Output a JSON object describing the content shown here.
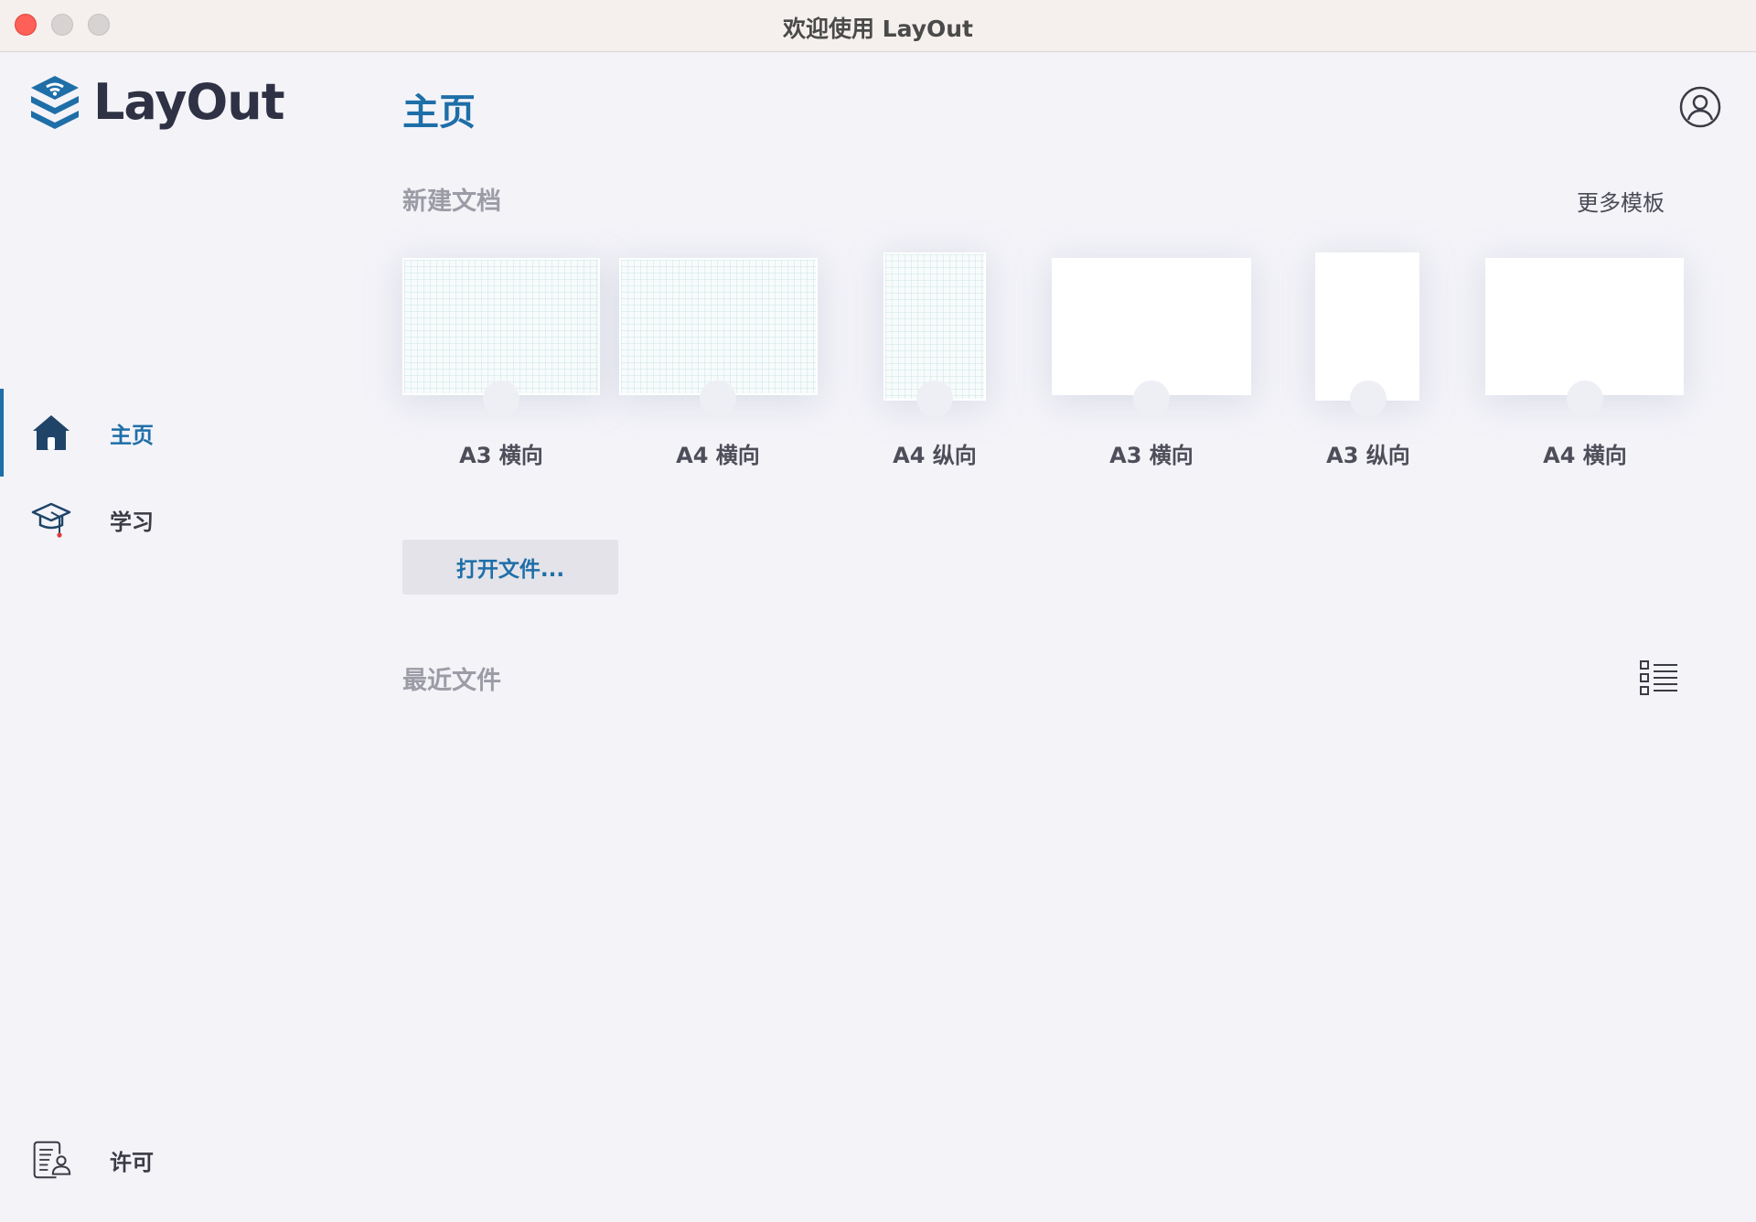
{
  "window": {
    "title": "欢迎使用 LayOut"
  },
  "sidebar": {
    "logo_text": "LayOut",
    "items": [
      {
        "label": "主页",
        "icon": "home-icon",
        "active": true
      },
      {
        "label": "学习",
        "icon": "graduation-cap-icon",
        "active": false
      }
    ],
    "footer_item": {
      "label": "许可",
      "icon": "license-icon"
    }
  },
  "main": {
    "title": "主页",
    "new_document": {
      "heading": "新建文档",
      "more_templates_label": "更多模板",
      "templates": [
        {
          "label": "A3 横向",
          "style": "grid",
          "orientation": "landscape"
        },
        {
          "label": "A4 横向",
          "style": "grid",
          "orientation": "landscape"
        },
        {
          "label": "A4 纵向",
          "style": "grid",
          "orientation": "portrait"
        },
        {
          "label": "A3 横向",
          "style": "plain",
          "orientation": "landscape"
        },
        {
          "label": "A3 纵向",
          "style": "plain",
          "orientation": "portrait"
        },
        {
          "label": "A4 横向",
          "style": "plain",
          "orientation": "landscape"
        }
      ]
    },
    "open_file_label": "打开文件...",
    "recent_files": {
      "heading": "最近文件"
    }
  },
  "colors": {
    "accent": "#1e6ea8",
    "background": "#f3f3f8",
    "titlebar": "#f5f0ed",
    "close_button": "#fe5f57"
  }
}
